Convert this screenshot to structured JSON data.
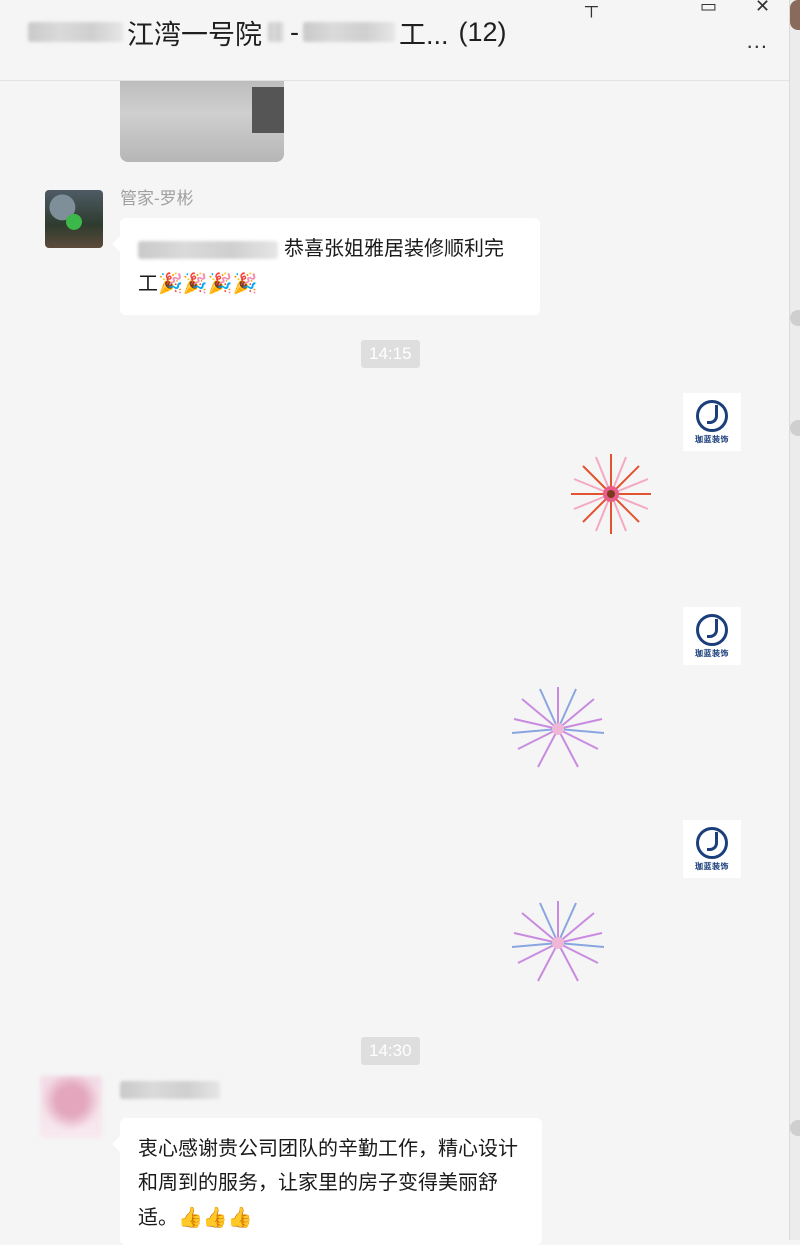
{
  "header": {
    "title_main": "江湾一号院",
    "title_sep": "-",
    "title_tail": "工...",
    "member_count": "(12)",
    "more_label": "..."
  },
  "messages": [
    {
      "sender": "管家-罗彬",
      "text": "恭喜张姐雅居装修顺利完工",
      "emoji": "🎉🎉🎉🎉"
    },
    {
      "text": "衷心感谢贵公司团队的辛勤工作，精心设计和周到的服务，让家里的房子变得美丽舒适。",
      "emoji": "👍👍👍"
    }
  ],
  "timestamps": [
    "14:15",
    "14:30"
  ],
  "colors": {
    "background": "#f5f5f5",
    "bubble": "#ffffff",
    "timestamp_bg": "#dedede",
    "sender_name": "#a0a0a0",
    "brand_blue": "#1b3f7a"
  },
  "icons": {
    "more": "more-icon",
    "party": "party-popper-emoji",
    "thumbs": "thumbs-up-emoji",
    "firework": "firework-sticker"
  }
}
